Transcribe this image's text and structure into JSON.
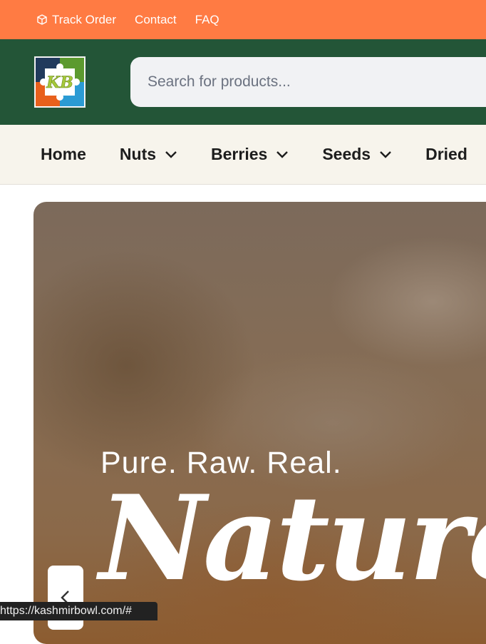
{
  "topbar": {
    "links": [
      {
        "label": "Track Order",
        "icon": "box-icon"
      },
      {
        "label": "Contact"
      },
      {
        "label": "FAQ"
      }
    ]
  },
  "header": {
    "logo_text": "KB",
    "search_placeholder": "Search for products..."
  },
  "nav": {
    "items": [
      {
        "label": "Home",
        "has_dropdown": false
      },
      {
        "label": "Nuts",
        "has_dropdown": true
      },
      {
        "label": "Berries",
        "has_dropdown": true
      },
      {
        "label": "Seeds",
        "has_dropdown": true
      },
      {
        "label": "Dried",
        "has_dropdown": false
      }
    ]
  },
  "hero": {
    "tagline": "Pure. Raw. Real.",
    "headline": "Nature'"
  },
  "statusbar": {
    "url": "https://kashmirbowl.com/#"
  },
  "colors": {
    "topbar": "#ff7b43",
    "header": "#235537",
    "nav": "#f7f4ec"
  }
}
